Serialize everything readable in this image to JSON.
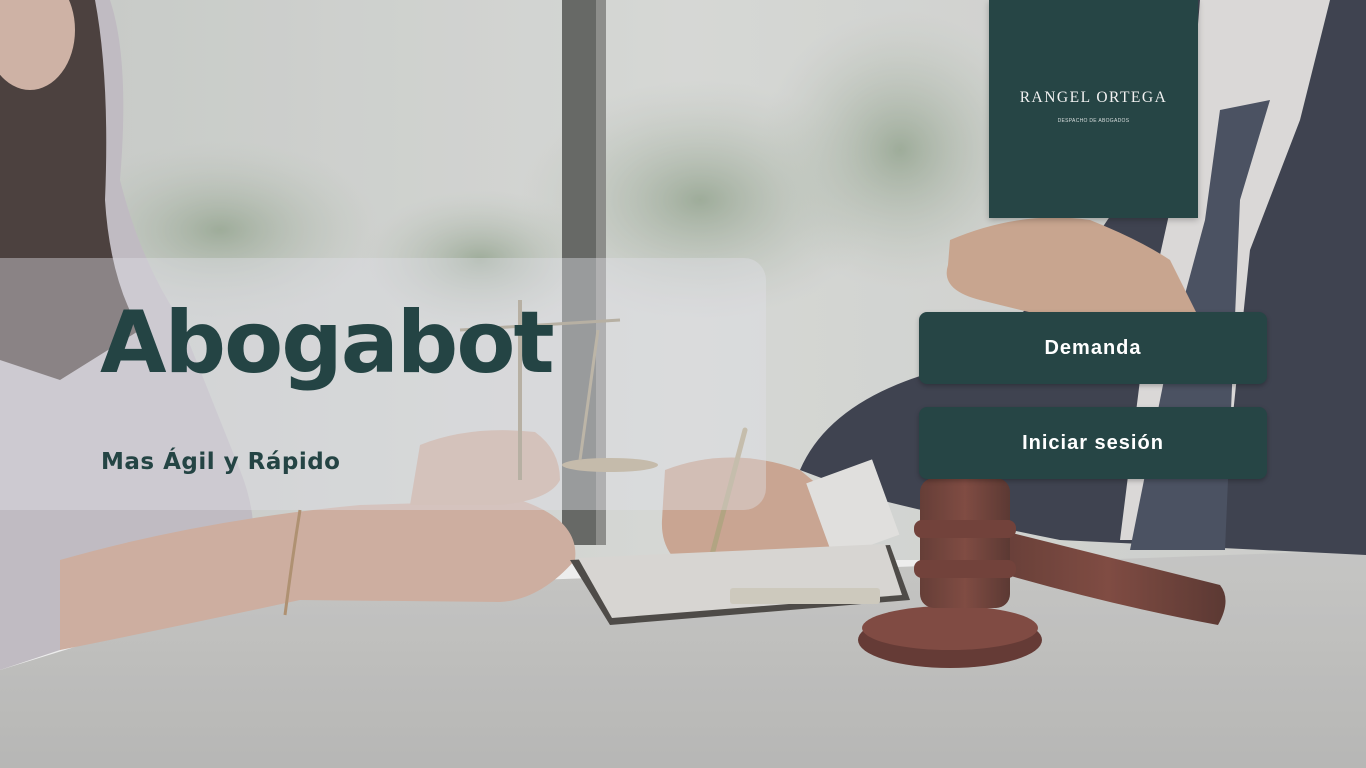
{
  "hero": {
    "title": "Abogabot",
    "subtitle": "Mas Ágil y Rápido"
  },
  "logo": {
    "name": "RANGEL ORTEGA",
    "tagline": "DESPACHO DE ABOGADOS"
  },
  "actions": {
    "demanda_label": "Demanda",
    "login_label": "Iniciar sesión"
  },
  "colors": {
    "brand": "#264545",
    "title_text": "#244444",
    "button_text": "#ffffff"
  }
}
